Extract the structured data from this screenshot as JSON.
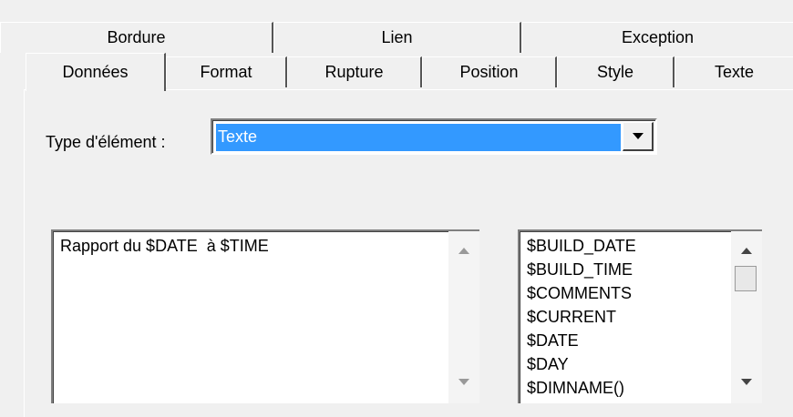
{
  "tabs_row1": [
    {
      "label": "Bordure"
    },
    {
      "label": "Lien"
    },
    {
      "label": "Exception"
    }
  ],
  "tabs_row2": [
    {
      "label": "Données",
      "active": true
    },
    {
      "label": "Format"
    },
    {
      "label": "Rupture"
    },
    {
      "label": "Position"
    },
    {
      "label": "Style"
    },
    {
      "label": "Texte"
    }
  ],
  "element_type": {
    "label": "Type d'élément :",
    "value": "Texte"
  },
  "text_area": {
    "value": "Rapport du $DATE  à $TIME"
  },
  "variables_list": {
    "items": [
      "$BUILD_DATE",
      "$BUILD_TIME",
      "$COMMENTS",
      "$CURRENT",
      "$DATE",
      "$DAY",
      "$DIMNAME()"
    ]
  },
  "colors": {
    "selection": "#3399ff",
    "background": "#f0f0f0"
  },
  "icons": {
    "combo_button": "chevron-down-icon",
    "scroll_up": "scroll-up-icon",
    "scroll_down": "scroll-down-icon"
  }
}
